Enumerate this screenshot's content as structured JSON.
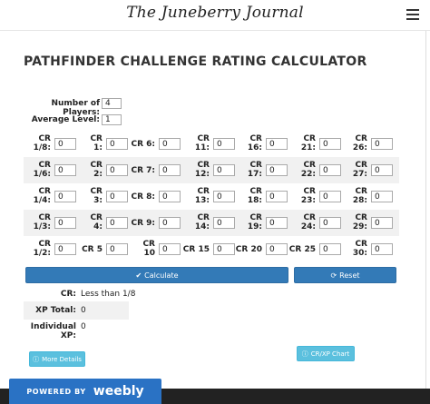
{
  "header": {
    "site_title": "The Juneberry Journal"
  },
  "page": {
    "title": "PATHFINDER CHALLENGE RATING CALCULATOR"
  },
  "inputs": {
    "players_label": "Number of Players:",
    "players_value": "4",
    "level_label": "Average Level:",
    "level_value": "1"
  },
  "cr_rows": [
    {
      "cells": [
        {
          "label": [
            "CR",
            "1/8:"
          ],
          "value": "0"
        },
        {
          "label": [
            "CR",
            "1:"
          ],
          "value": "0"
        },
        {
          "label": [
            "CR 6:"
          ],
          "value": "0"
        },
        {
          "label": [
            "CR",
            "11:"
          ],
          "value": "0"
        },
        {
          "label": [
            "CR",
            "16:"
          ],
          "value": "0"
        },
        {
          "label": [
            "CR",
            "21:"
          ],
          "value": "0"
        },
        {
          "label": [
            "CR",
            "26:"
          ],
          "value": "0"
        }
      ]
    },
    {
      "cells": [
        {
          "label": [
            "CR",
            "1/6:"
          ],
          "value": "0"
        },
        {
          "label": [
            "CR",
            "2:"
          ],
          "value": "0"
        },
        {
          "label": [
            "CR 7:"
          ],
          "value": "0"
        },
        {
          "label": [
            "CR",
            "12:"
          ],
          "value": "0"
        },
        {
          "label": [
            "CR",
            "17:"
          ],
          "value": "0"
        },
        {
          "label": [
            "CR",
            "22:"
          ],
          "value": "0"
        },
        {
          "label": [
            "CR",
            "27:"
          ],
          "value": "0"
        }
      ]
    },
    {
      "cells": [
        {
          "label": [
            "CR",
            "1/4:"
          ],
          "value": "0"
        },
        {
          "label": [
            "CR",
            "3:"
          ],
          "value": "0"
        },
        {
          "label": [
            "CR 8:"
          ],
          "value": "0"
        },
        {
          "label": [
            "CR",
            "13:"
          ],
          "value": "0"
        },
        {
          "label": [
            "CR",
            "18:"
          ],
          "value": "0"
        },
        {
          "label": [
            "CR",
            "23:"
          ],
          "value": "0"
        },
        {
          "label": [
            "CR",
            "28:"
          ],
          "value": "0"
        }
      ]
    },
    {
      "cells": [
        {
          "label": [
            "CR",
            "1/3:"
          ],
          "value": "0"
        },
        {
          "label": [
            "CR",
            "4:"
          ],
          "value": "0"
        },
        {
          "label": [
            "CR 9:"
          ],
          "value": "0"
        },
        {
          "label": [
            "CR",
            "14:"
          ],
          "value": "0"
        },
        {
          "label": [
            "CR",
            "19:"
          ],
          "value": "0"
        },
        {
          "label": [
            "CR",
            "24:"
          ],
          "value": "0"
        },
        {
          "label": [
            "CR",
            "29:"
          ],
          "value": "0"
        }
      ]
    },
    {
      "cells": [
        {
          "label": [
            "CR",
            "1/2:"
          ],
          "value": "0"
        },
        {
          "label": [
            "CR 5"
          ],
          "value": "0"
        },
        {
          "label": [
            "CR",
            "10"
          ],
          "value": "0"
        },
        {
          "label": [
            "CR 15"
          ],
          "value": "0"
        },
        {
          "label": [
            "CR 20"
          ],
          "value": "0"
        },
        {
          "label": [
            "CR 25"
          ],
          "value": "0"
        },
        {
          "label": [
            "CR",
            "30:"
          ],
          "value": "0"
        }
      ]
    }
  ],
  "buttons": {
    "calculate": "Calculate",
    "reset": "Reset",
    "more_details": "More Details",
    "cr_xp_chart": "CR/XP Chart"
  },
  "results": {
    "cr_label": "CR:",
    "cr_value": "Less than 1/8",
    "xp_total_label": "XP Total:",
    "xp_total_value": "0",
    "individual_xp_label": "Individual XP:",
    "individual_xp_value": "0"
  },
  "badge": {
    "powered_by": "POWERED BY",
    "brand": "weebly"
  },
  "colors": {
    "primary": "#337ab7",
    "info": "#5bc0de",
    "weebly": "#2a72c4",
    "footer": "#222222"
  }
}
